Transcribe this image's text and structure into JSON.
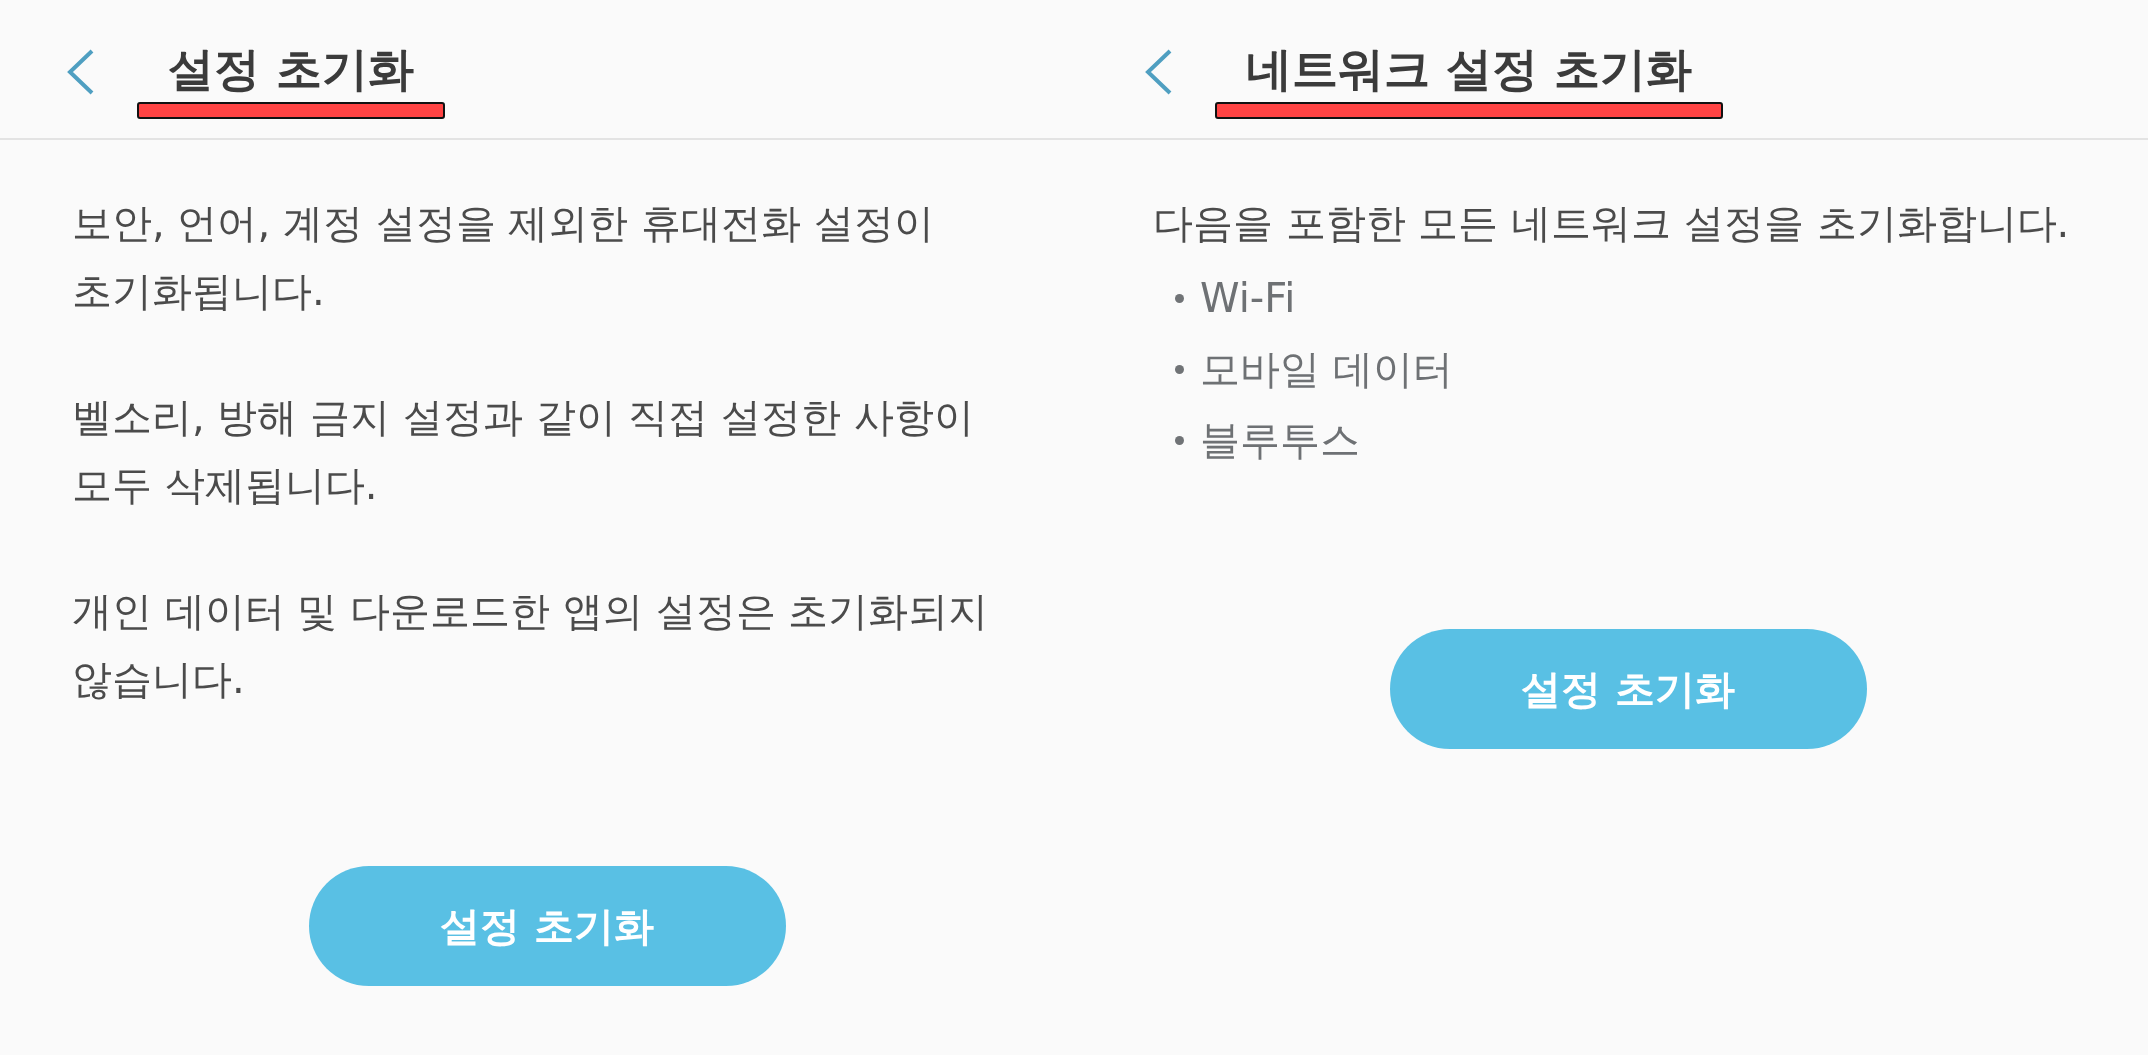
{
  "panels": [
    {
      "header": {
        "title": "설정 초기화",
        "highlighted": true
      },
      "paragraphs": [
        "보안, 언어, 계정 설정을 제외한 휴대전화 설정이 초기화됩니다.",
        "벨소리, 방해 금지 설정과 같이 직접 설정한 사항이 모두 삭제됩니다.",
        "개인 데이터 및 다운로드한 앱의 설정은 초기화되지 않습니다."
      ],
      "button": {
        "label": "설정 초기화"
      }
    },
    {
      "header": {
        "title": "네트워크 설정 초기화",
        "highlighted": true
      },
      "paragraphs": [
        "다음을 포함한 모든 네트워크 설정을 초기화합니다."
      ],
      "bullets": [
        "Wi-Fi",
        "모바일 데이터",
        "블루투스"
      ],
      "button": {
        "label": "설정 초기화"
      }
    }
  ]
}
